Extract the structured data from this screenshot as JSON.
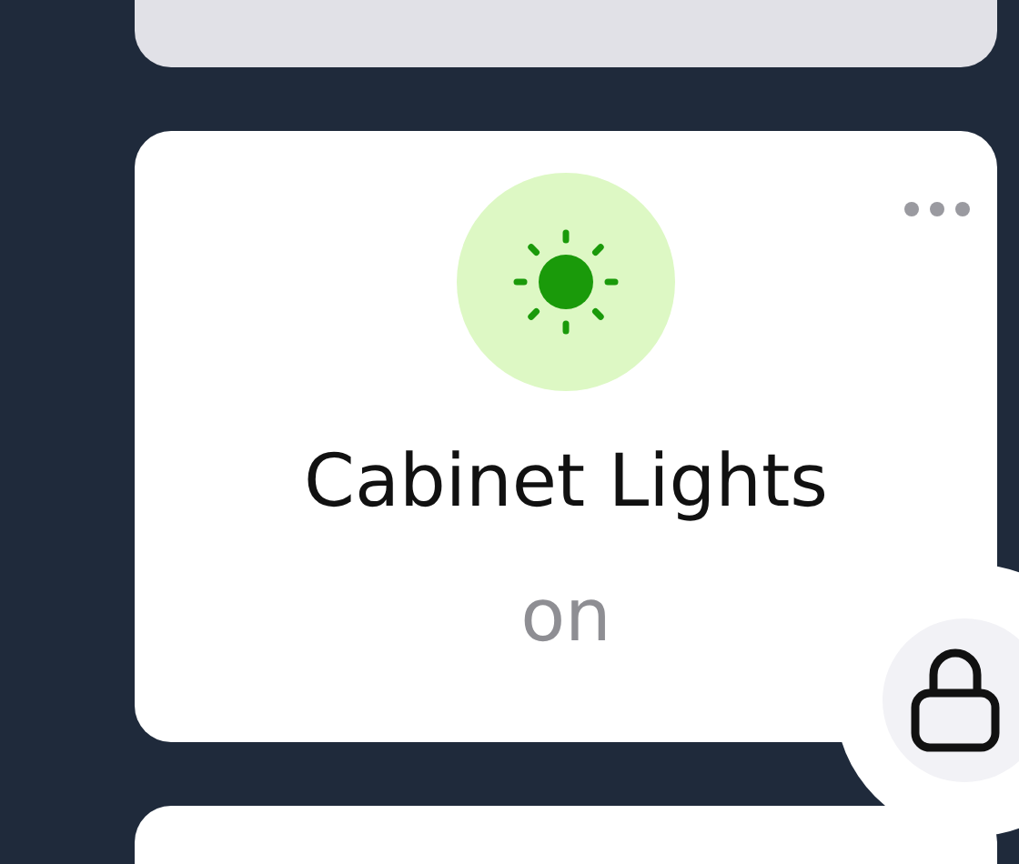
{
  "device": {
    "name": "Cabinet Lights",
    "state": "on",
    "on": true
  }
}
